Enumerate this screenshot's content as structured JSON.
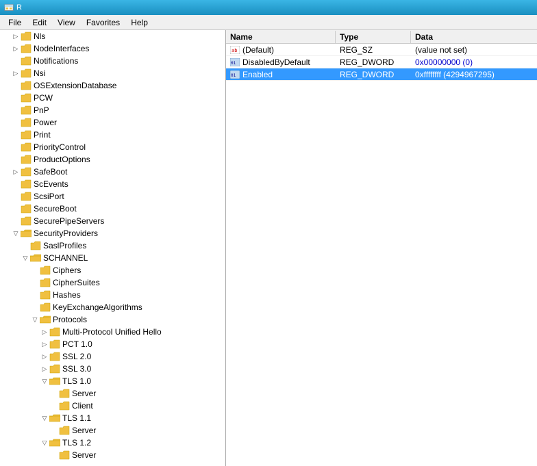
{
  "titleBar": {
    "icon": "regedit",
    "title": "R"
  },
  "menuBar": {
    "items": [
      "File",
      "Edit",
      "View",
      "Favorites",
      "Help"
    ]
  },
  "treePanel": {
    "items": [
      {
        "id": "nls",
        "label": "Nls",
        "indent": 1,
        "expanded": false,
        "hasChildren": true
      },
      {
        "id": "nodeinterfaces",
        "label": "NodeInterfaces",
        "indent": 1,
        "expanded": false,
        "hasChildren": true
      },
      {
        "id": "notifications",
        "label": "Notifications",
        "indent": 1,
        "expanded": false,
        "hasChildren": false
      },
      {
        "id": "nsi",
        "label": "Nsi",
        "indent": 1,
        "expanded": false,
        "hasChildren": true
      },
      {
        "id": "osextdb",
        "label": "OSExtensionDatabase",
        "indent": 1,
        "expanded": false,
        "hasChildren": false
      },
      {
        "id": "pcw",
        "label": "PCW",
        "indent": 1,
        "expanded": false,
        "hasChildren": false
      },
      {
        "id": "pnp",
        "label": "PnP",
        "indent": 1,
        "expanded": false,
        "hasChildren": false
      },
      {
        "id": "power",
        "label": "Power",
        "indent": 1,
        "expanded": false,
        "hasChildren": false
      },
      {
        "id": "print",
        "label": "Print",
        "indent": 1,
        "expanded": false,
        "hasChildren": false
      },
      {
        "id": "prioritycontrol",
        "label": "PriorityControl",
        "indent": 1,
        "expanded": false,
        "hasChildren": false
      },
      {
        "id": "productoptions",
        "label": "ProductOptions",
        "indent": 1,
        "expanded": false,
        "hasChildren": false
      },
      {
        "id": "safeboot",
        "label": "SafeBoot",
        "indent": 1,
        "expanded": false,
        "hasChildren": true
      },
      {
        "id": "scevents",
        "label": "ScEvents",
        "indent": 1,
        "expanded": false,
        "hasChildren": false
      },
      {
        "id": "scsiport",
        "label": "ScsiPort",
        "indent": 1,
        "expanded": false,
        "hasChildren": false
      },
      {
        "id": "secureboot",
        "label": "SecureBoot",
        "indent": 1,
        "expanded": false,
        "hasChildren": false
      },
      {
        "id": "securepipe",
        "label": "SecurePipeServers",
        "indent": 1,
        "expanded": false,
        "hasChildren": false
      },
      {
        "id": "secproviders",
        "label": "SecurityProviders",
        "indent": 1,
        "expanded": true,
        "hasChildren": true
      },
      {
        "id": "saslprofiles",
        "label": "SaslProfiles",
        "indent": 2,
        "expanded": false,
        "hasChildren": false
      },
      {
        "id": "schannel",
        "label": "SCHANNEL",
        "indent": 2,
        "expanded": true,
        "hasChildren": true
      },
      {
        "id": "ciphers",
        "label": "Ciphers",
        "indent": 3,
        "expanded": false,
        "hasChildren": false,
        "selected": false
      },
      {
        "id": "ciphersuites",
        "label": "CipherSuites",
        "indent": 3,
        "expanded": false,
        "hasChildren": false
      },
      {
        "id": "hashes",
        "label": "Hashes",
        "indent": 3,
        "expanded": false,
        "hasChildren": false
      },
      {
        "id": "keyexchange",
        "label": "KeyExchangeAlgorithms",
        "indent": 3,
        "expanded": false,
        "hasChildren": false
      },
      {
        "id": "protocols",
        "label": "Protocols",
        "indent": 3,
        "expanded": true,
        "hasChildren": true
      },
      {
        "id": "multiproto",
        "label": "Multi-Protocol Unified Hello",
        "indent": 4,
        "expanded": false,
        "hasChildren": true
      },
      {
        "id": "pct10",
        "label": "PCT 1.0",
        "indent": 4,
        "expanded": false,
        "hasChildren": true
      },
      {
        "id": "ssl20",
        "label": "SSL 2.0",
        "indent": 4,
        "expanded": false,
        "hasChildren": true
      },
      {
        "id": "ssl30",
        "label": "SSL 3.0",
        "indent": 4,
        "expanded": false,
        "hasChildren": true
      },
      {
        "id": "tls10",
        "label": "TLS 1.0",
        "indent": 4,
        "expanded": true,
        "hasChildren": true
      },
      {
        "id": "tls10server",
        "label": "Server",
        "indent": 5,
        "expanded": false,
        "hasChildren": false
      },
      {
        "id": "tls10client",
        "label": "Client",
        "indent": 5,
        "expanded": false,
        "hasChildren": false
      },
      {
        "id": "tls11",
        "label": "TLS 1.1",
        "indent": 4,
        "expanded": true,
        "hasChildren": true
      },
      {
        "id": "tls11server",
        "label": "Server",
        "indent": 5,
        "expanded": false,
        "hasChildren": false
      },
      {
        "id": "tls12",
        "label": "TLS 1.2",
        "indent": 4,
        "expanded": true,
        "hasChildren": true
      },
      {
        "id": "tls12server",
        "label": "Server",
        "indent": 5,
        "expanded": false,
        "hasChildren": false
      }
    ]
  },
  "registryPanel": {
    "columns": {
      "name": "Name",
      "type": "Type",
      "data": "Data"
    },
    "rows": [
      {
        "id": "default",
        "name": "(Default)",
        "type": "REG_SZ",
        "data": "(value not set)",
        "iconType": "ab",
        "selected": false
      },
      {
        "id": "disabledbydefault",
        "name": "DisabledByDefault",
        "type": "REG_DWORD",
        "data": "0x00000000 (0)",
        "iconType": "dword",
        "selected": false,
        "dataColor": "#0000cc"
      },
      {
        "id": "enabled",
        "name": "Enabled",
        "type": "REG_DWORD",
        "data": "0xffffffff (4294967295)",
        "iconType": "dword",
        "selected": true
      }
    ]
  }
}
